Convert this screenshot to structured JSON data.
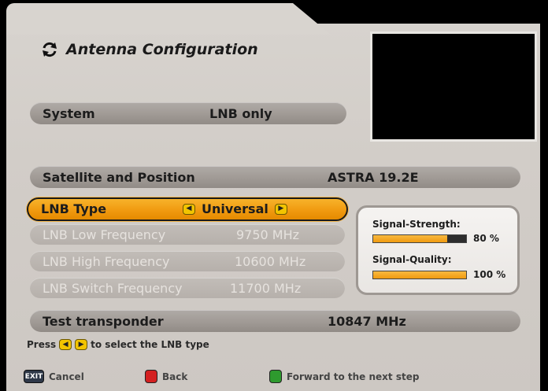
{
  "header": {
    "title": "Antenna Configuration",
    "icon": "circular-arrows-icon"
  },
  "rows": {
    "system": {
      "label": "System",
      "value": "LNB only"
    },
    "satellite": {
      "label": "Satellite and Position",
      "value": "ASTRA 19.2E"
    },
    "lnb_type": {
      "label": "LNB Type",
      "value": "Universal"
    },
    "lnb_low": {
      "label": "LNB Low Frequency",
      "value": "9750 MHz"
    },
    "lnb_high": {
      "label": "LNB High Frequency",
      "value": "10600 MHz"
    },
    "lnb_switch": {
      "label": "LNB Switch Frequency",
      "value": "11700 MHz"
    },
    "transponder": {
      "label": "Test transponder",
      "value": "10847 MHz"
    }
  },
  "signal": {
    "strength_label": "Signal-Strength:",
    "strength_value": "80 %",
    "strength_fraction": 0.8,
    "quality_label": "Signal-Quality:",
    "quality_value": "100 %",
    "quality_fraction": 1.0
  },
  "hint": {
    "prefix": "Press",
    "suffix": "to select the LNB type"
  },
  "footer": {
    "exit_key": "EXIT",
    "cancel": "Cancel",
    "back": "Back",
    "forward": "Forward to the next step"
  },
  "colors": {
    "active": "#f09a10",
    "red_key": "#d42020",
    "green_key": "#2e9a2e",
    "yellow_key": "#f2c400"
  }
}
